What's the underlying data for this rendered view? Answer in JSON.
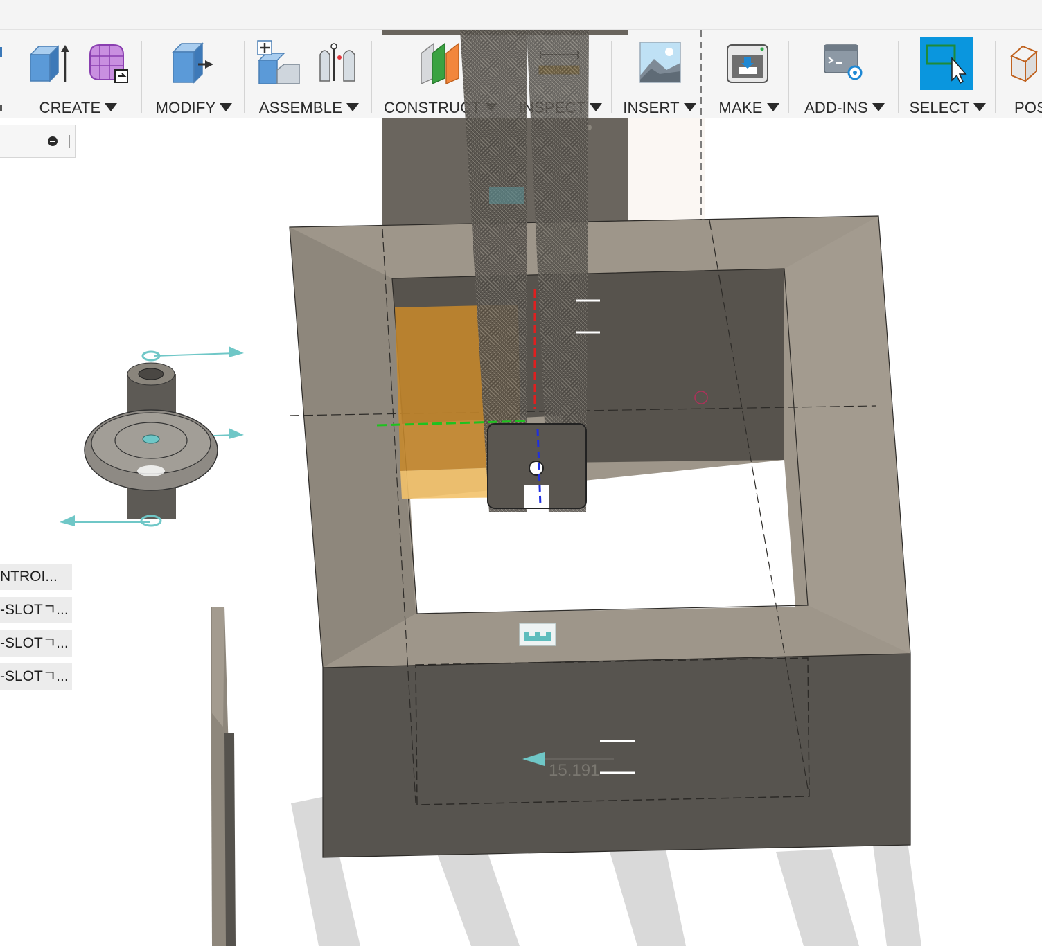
{
  "toolbar": {
    "groups": [
      {
        "label": "CREATE"
      },
      {
        "label": "MODIFY"
      },
      {
        "label": "ASSEMBLE"
      },
      {
        "label": "CONSTRUCT"
      },
      {
        "label": "INSPECT"
      },
      {
        "label": "INSERT"
      },
      {
        "label": "MAKE"
      },
      {
        "label": "ADD-INS"
      },
      {
        "label": "SELECT"
      },
      {
        "label": "POS"
      }
    ]
  },
  "browser": {
    "items": [
      {
        "label": "NTROI..."
      },
      {
        "label": "-SLOTㄱ..."
      },
      {
        "label": "-SLOTㄱ..."
      },
      {
        "label": "-SLOTㄱ..."
      }
    ]
  },
  "viewport": {
    "dimension_value": "15.191"
  },
  "colors": {
    "accent": "#0a96de",
    "selection": "#f0a020",
    "body_top": "#9e968a",
    "body_front": "#57544f"
  }
}
